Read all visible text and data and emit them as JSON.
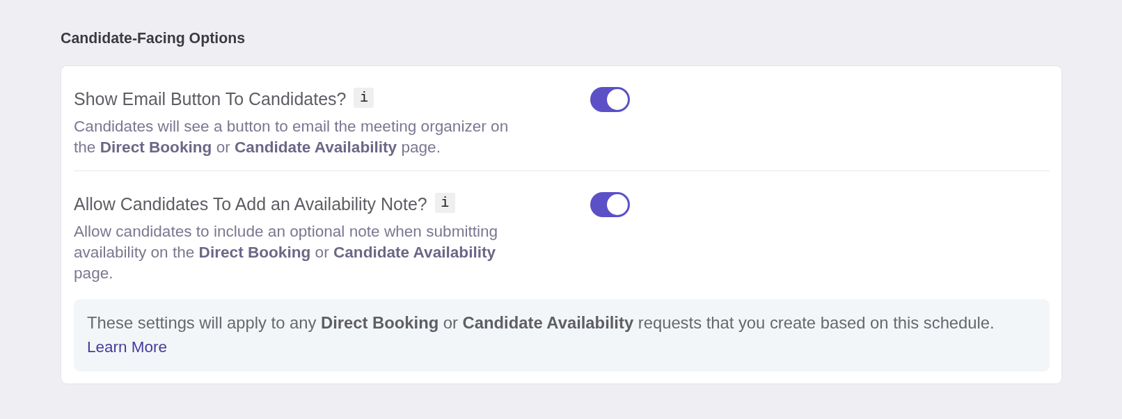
{
  "section_title": "Candidate-Facing Options",
  "settings": [
    {
      "label": "Show Email Button To Candidates?",
      "info": "i",
      "description": "Candidates will see a button to email the meeting organizer on the **Direct Booking** or **Candidate Availability** page.",
      "on": true
    },
    {
      "label": "Allow Candidates To Add an Availability Note?",
      "info": "i",
      "description": "Allow candidates to include an optional note when submitting availability on the **Direct Booking** or **Candidate Availability** page.",
      "on": true
    }
  ],
  "notice": {
    "text": "These settings will apply to any **Direct Booking** or **Candidate Availability** requests that you create based on this schedule.",
    "link": "Learn More"
  }
}
